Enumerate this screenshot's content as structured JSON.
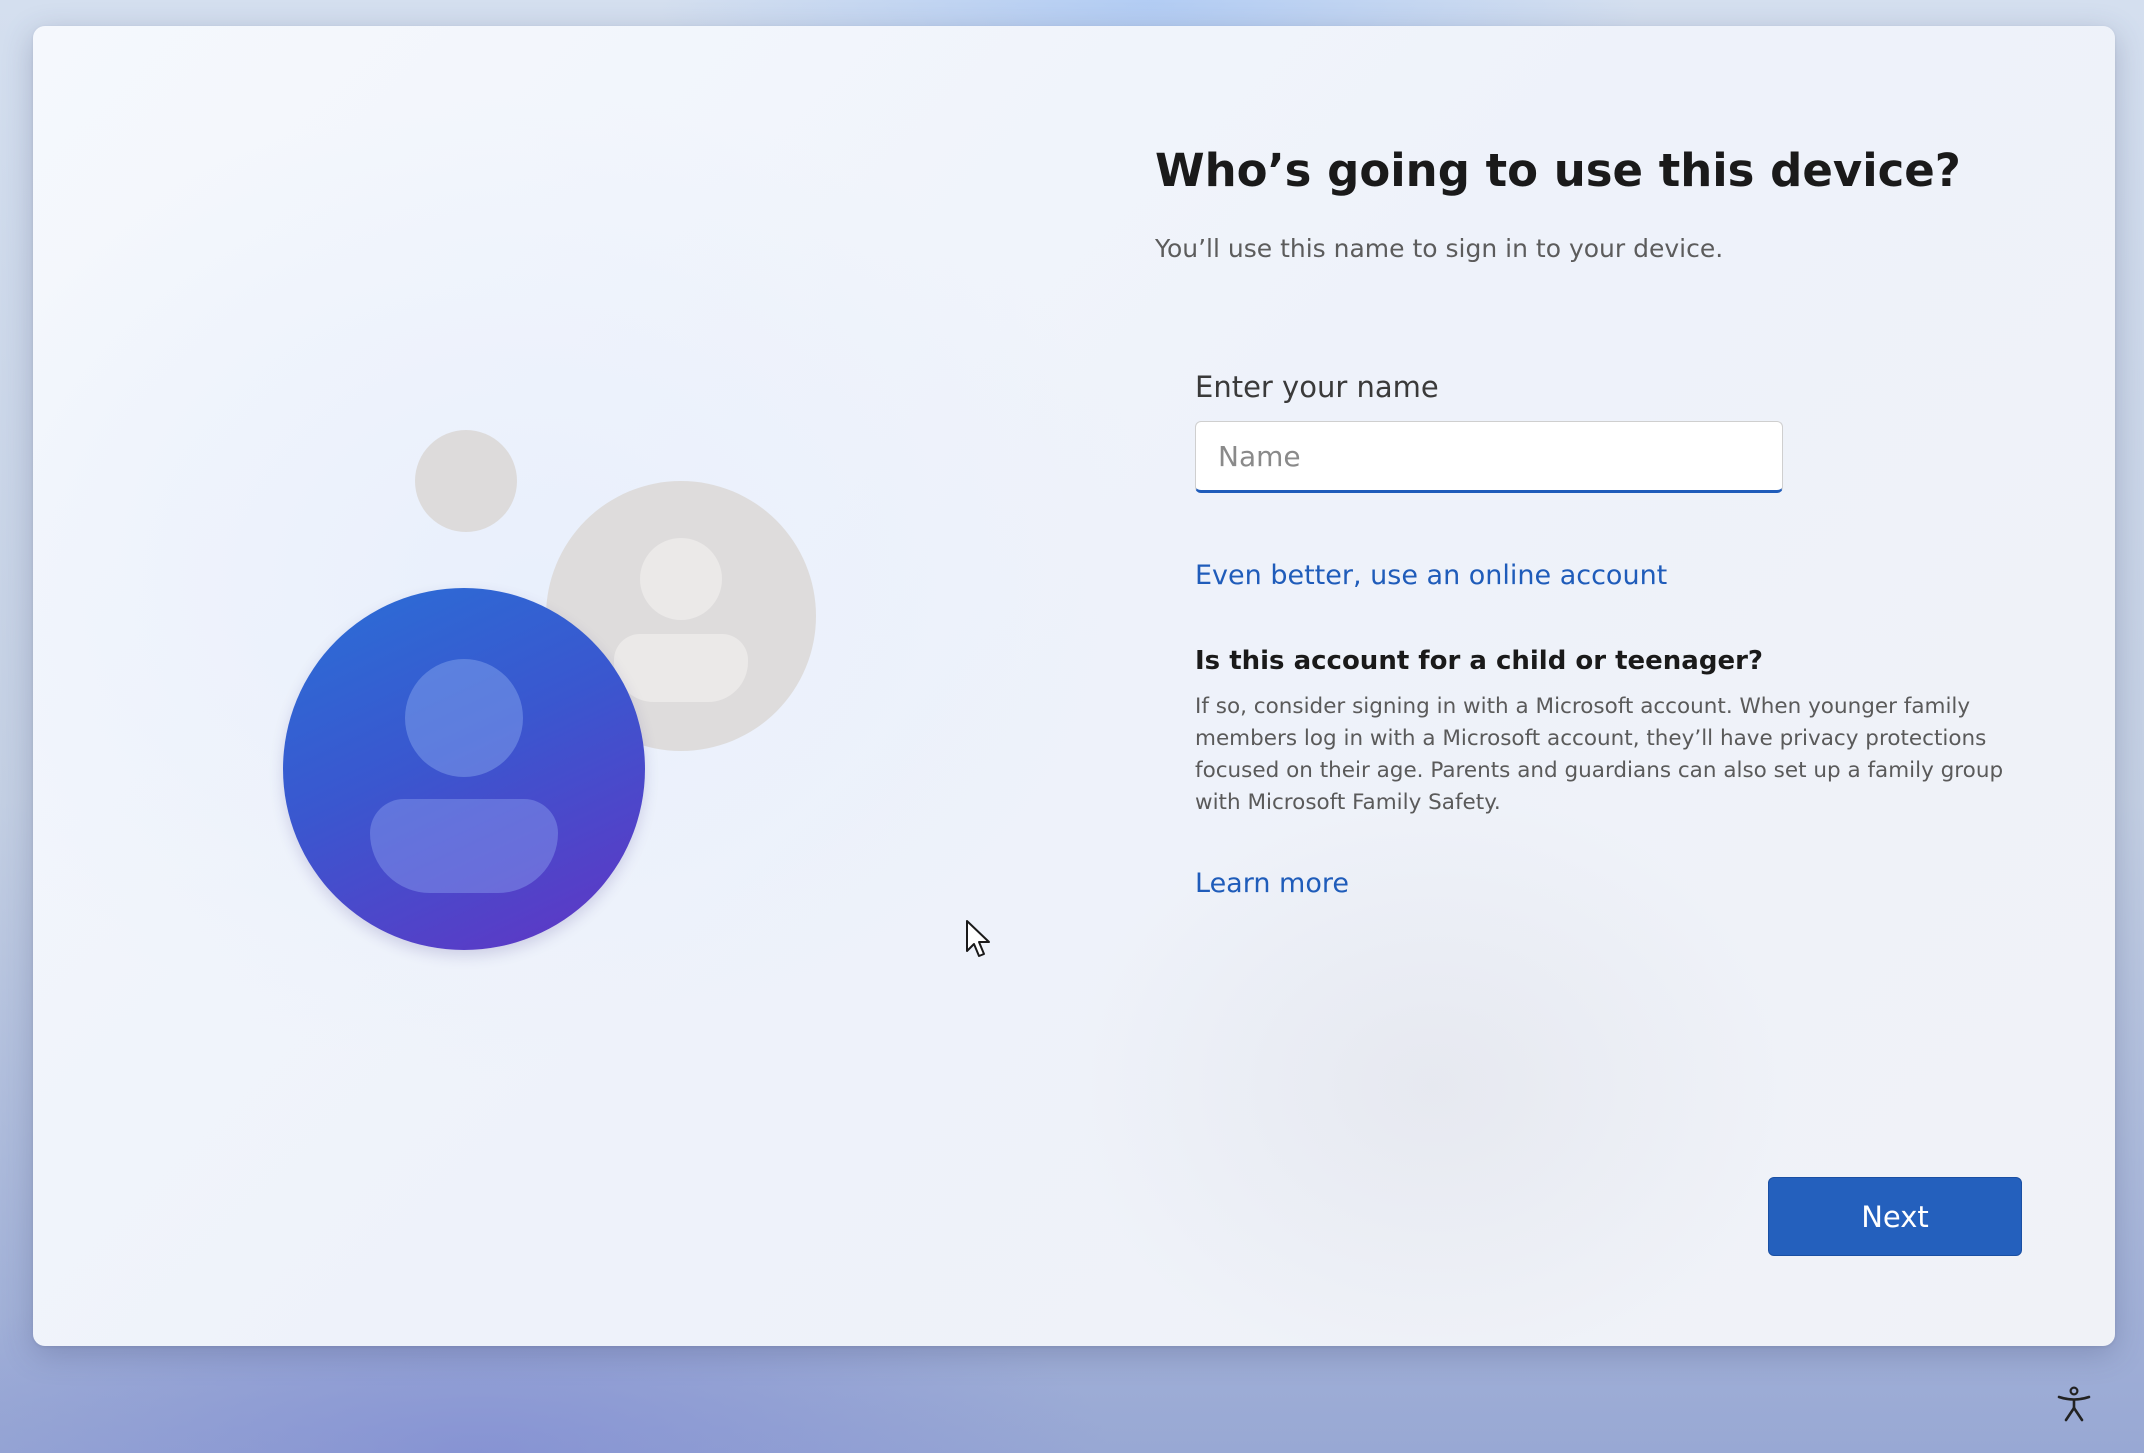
{
  "page": {
    "title": "Who’s going to use this device?",
    "subtitle": "You’ll use this name to sign in to your device."
  },
  "name_field": {
    "label": "Enter your name",
    "placeholder": "Name",
    "value": ""
  },
  "links": {
    "online_account": "Even better, use an online account",
    "learn_more": "Learn more"
  },
  "child_section": {
    "heading": "Is this account for a child or teenager?",
    "body": "If so, consider signing in with a Microsoft account. When younger family members log in with a Microsoft account, they’ll have privacy protections focused on their age. Parents and guardians can also set up a family group with Microsoft Family Safety."
  },
  "buttons": {
    "next": "Next"
  },
  "colors": {
    "accent": "#2460bd",
    "link": "#1f5cba",
    "avatar_gradient_start": "#2a6fd6",
    "avatar_gradient_end": "#6234c4"
  },
  "icons": {
    "illustration": "people-illustration",
    "cursor": "mouse-pointer-icon",
    "accessibility": "accessibility-icon"
  }
}
